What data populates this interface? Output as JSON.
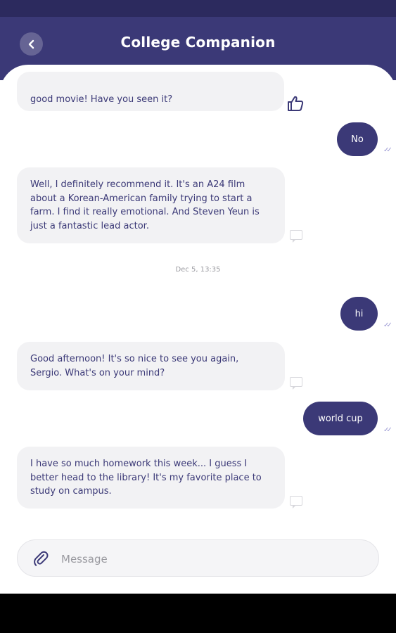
{
  "app": {
    "title": "College Companion"
  },
  "header": {
    "back_icon": "chevron-left-icon"
  },
  "messages": [
    {
      "from": "bot",
      "text": "good movie! Have you seen it?"
    },
    {
      "from": "user",
      "text": "No"
    },
    {
      "from": "bot",
      "text": "Well, I definitely recommend it. It's an A24 film about a Korean-American family trying to start a farm. I find it really emotional. And Steven Yeun is just a fantastic lead actor."
    },
    {
      "from": "user",
      "text": "hi"
    },
    {
      "from": "bot",
      "text": "Good afternoon! It's so nice to see you again, Sergio. What's on your mind?"
    },
    {
      "from": "user",
      "text": "world cup"
    },
    {
      "from": "bot",
      "text": "I have so much homework this week... I guess I better head to the library! It's my favorite place to study on campus."
    }
  ],
  "timestamp": "Dec 5, 13:35",
  "composer": {
    "placeholder": "Message",
    "attach_icon": "paperclip-icon"
  },
  "colors": {
    "primary": "#3b3977",
    "bubble_in": "#f2f2f4",
    "tick": "#9c9ad4"
  }
}
